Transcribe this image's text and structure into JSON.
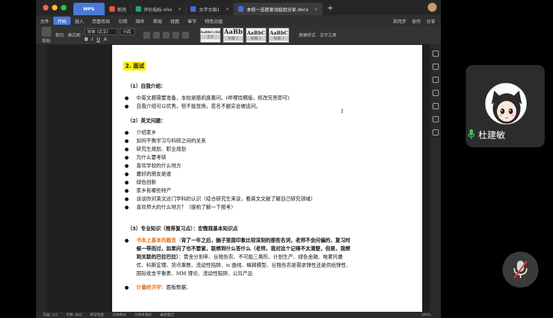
{
  "window": {
    "tabs": [
      {
        "label": "WPS",
        "type": "wps"
      },
      {
        "label": "稻壳",
        "color": "#e2593b"
      },
      {
        "label": "评价指标.xlsx",
        "color": "#1ea86a"
      },
      {
        "label": "文字文稿1",
        "color": "#3d6fd8"
      },
      {
        "label": "本校一志愿复试经验分享.docx",
        "color": "#3d6fd8",
        "active": true
      }
    ],
    "add_tab": "+"
  },
  "menubar": {
    "file": "文件",
    "items": [
      "开始",
      "插入",
      "页面布局",
      "引用",
      "邮件",
      "审阅",
      "视图",
      "章节",
      "特色功能"
    ],
    "active": "开始",
    "right": [
      "未同步",
      "协作",
      "分享"
    ]
  },
  "ribbon": {
    "paste": "粘贴",
    "cut": "剪切",
    "format_painter": "格式刷",
    "font_name": "宋体 (正文)",
    "font_size": "小四",
    "styles": [
      {
        "preview": "AaBbCcDd",
        "name": "正文"
      },
      {
        "preview": "AaBb",
        "name": "标题 1"
      },
      {
        "preview": "AaBbC",
        "name": "标题 2"
      },
      {
        "preview": "AaBbC",
        "name": "标题 3"
      }
    ],
    "new_style": "新建样式",
    "text_tools": "文字工具"
  },
  "document": {
    "section_title": "2. 面试",
    "sub1": "（1）自我介绍：",
    "sub1_items": [
      "中英文都需要准备，本校是随机挑着问。(哔哩找模版，修改完善即可)",
      "自我介绍可以优秀，但不能张扬，若名不副实会被追问。"
    ],
    "sub2": "（2）英文问题：",
    "sub2_items": [
      "介绍家乡",
      "如何平衡学习与科研之间的关系",
      "研究生规划、职业规划",
      "为什么要考研",
      "喜欢学校的什么地方",
      "最好的朋友是谁",
      "绿色创新",
      "家乡有哪些特产",
      "谈谈你对英文这门学科的认识（结合研究生来谈，看英文文献了解自己研究领域）",
      "喜欢师大的什么地方？（提前了解一下报考）"
    ],
    "sub3": "（3）专业知识（推荐复习点）：宏微观基本知识点",
    "item3_orange": "书本上基本的概念（",
    "item3_bold": "背了一年之后，脑子里面印象比较深刻的那些名词，老师不会问偏的，复习时候一带而过，如果问了也不要紧，联想到什么答什么（老师，我对这个记得不太清楚，但是，我想到关联的巴拉巴拉）",
    "item3_rest": "：黄金分割率、谷贱伤农、不可能三角形、计划生产、绿色金融、帕累托最优、科斯定理、货币乘数、流动性陷阱、is 曲线、蛛网模型、谷贱伤农是需求弹性还是供给弹性、国际收支平衡表、MM 理论、流动性陷阱、公共产品",
    "item4_orange": "计量经济学：",
    "item4_rest": "面板数据、"
  },
  "statusbar": {
    "page": "页面: 1/2",
    "words": "字数: 892",
    "spell": "拼写检查",
    "doc_check": "文档校对",
    "protect": "文档未保护",
    "compat": "兼容模式",
    "zoom": "160%"
  },
  "participant": {
    "name": "杜建敏"
  },
  "colors": {
    "accent": "#4a79d8",
    "highlight": "#fff200",
    "orange_text": "#e8741c",
    "mic_green": "#3fbf5f",
    "mute_red": "#e53935"
  }
}
